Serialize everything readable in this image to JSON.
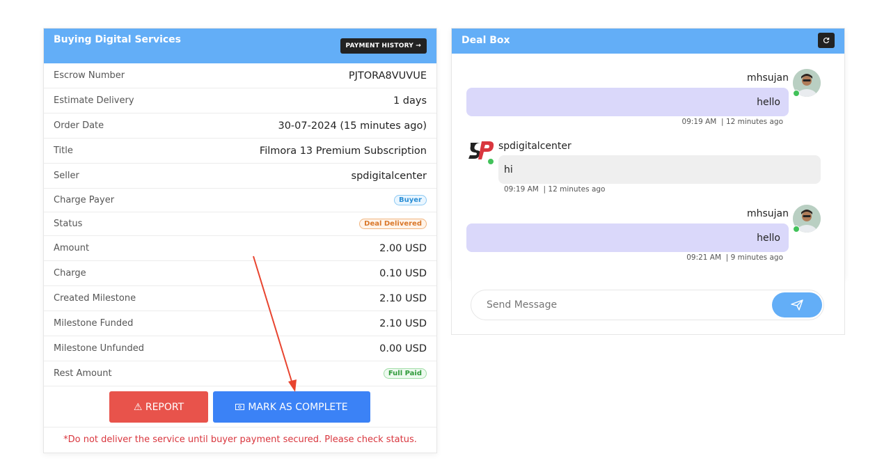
{
  "left": {
    "title": "Buying Digital Services",
    "history_label": "PAYMENT HISTORY →",
    "rows": [
      {
        "label": "Escrow Number",
        "value": "PJTORA8VUVUE"
      },
      {
        "label": "Estimate Delivery",
        "value": "1 days"
      },
      {
        "label": "Order Date",
        "value": "30-07-2024 (15 minutes ago)"
      },
      {
        "label": "Title",
        "value": "Filmora 13 Premium Subscription"
      },
      {
        "label": "Seller",
        "value": "spdigitalcenter"
      },
      {
        "label": "Charge Payer",
        "value": "Buyer"
      },
      {
        "label": "Status",
        "value": "Deal Delivered"
      },
      {
        "label": "Amount",
        "value": "2.00 USD"
      },
      {
        "label": "Charge",
        "value": "0.10 USD"
      },
      {
        "label": "Created Milestone",
        "value": "2.10 USD"
      },
      {
        "label": "Milestone Funded",
        "value": "2.10 USD"
      },
      {
        "label": "Milestone Unfunded",
        "value": "0.00 USD"
      },
      {
        "label": "Rest Amount",
        "value": "Full Paid"
      }
    ],
    "report_label": "⚠ REPORT",
    "complete_label": "MARK AS COMPLETE",
    "warning": "*Do not deliver the service until buyer payment secured. Please check status."
  },
  "deal": {
    "title": "Deal Box",
    "messages": [
      {
        "sender": "mhsujan",
        "text": "hello",
        "time": "09:19 AM",
        "ago": "12 minutes ago"
      },
      {
        "sender": "spdigitalcenter",
        "text": "hi",
        "time": "09:19 AM",
        "ago": "12 minutes ago"
      },
      {
        "sender": "mhsujan",
        "text": "hello",
        "time": "09:21 AM",
        "ago": "9 minutes ago"
      }
    ],
    "input_placeholder": "Send Message"
  },
  "colors": {
    "header": "#63aef7",
    "report": "#e8534b",
    "complete": "#3b82f6",
    "annotation_arrow": "#e8442f"
  }
}
